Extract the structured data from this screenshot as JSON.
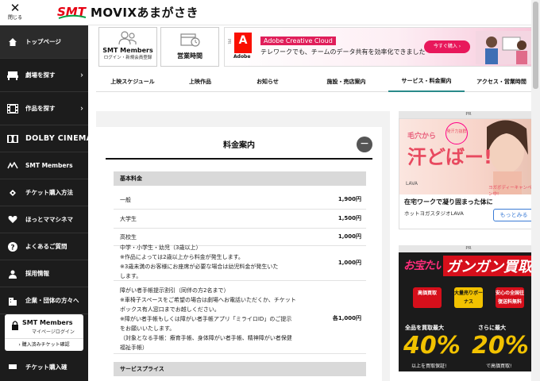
{
  "header": {
    "close_label": "閉じる",
    "close_symbol": "✕",
    "logo_text": "SMT",
    "site_title": "MOVIXあまがさき"
  },
  "sidebar": {
    "items": [
      {
        "label": "トップページ",
        "icon": "home-icon"
      },
      {
        "label": "劇場を探す",
        "icon": "theater-seat-icon",
        "chevron": "›"
      },
      {
        "label": "作品を探す",
        "icon": "film-icon",
        "chevron": "›"
      },
      {
        "label": "DOLBY CINEMA",
        "icon": "dolby-icon"
      },
      {
        "label": "SMT Members",
        "icon": "smt-logo-icon"
      },
      {
        "label": "チケット購入方法",
        "icon": "ticket-icon"
      },
      {
        "label": "ほっとママシネマ",
        "icon": "heart-icon"
      },
      {
        "label": "よくあるご質問",
        "icon": "question-icon"
      },
      {
        "label": "採用情報",
        "icon": "person-icon"
      },
      {
        "label": "企業・団体の方々へ",
        "icon": "building-icon"
      }
    ],
    "members": {
      "title": "SMT Members",
      "sub": "マイページログイン",
      "link": "購入済みチケット確認"
    },
    "bottom_label": "チケット購入確"
  },
  "cards": {
    "members": {
      "title": "SMT Members",
      "sub": "ログイン・新規会員登録"
    },
    "hours": {
      "title": "営業時間"
    }
  },
  "ad_banner": {
    "pr": "PR",
    "logo": "A",
    "brand": "Adobe",
    "headline": "Adobe Creative Cloud",
    "body": "テレワークでも、チームのデータ共有を効率化できました",
    "cta": "今すぐ購入 ›"
  },
  "tabs": [
    {
      "label": "上映スケジュール",
      "active": false
    },
    {
      "label": "上映作品",
      "active": false
    },
    {
      "label": "お知らせ",
      "active": false
    },
    {
      "label": "施設・売店案内",
      "active": false
    },
    {
      "label": "サービス・料金案内",
      "active": true
    },
    {
      "label": "アクセス・営業時間",
      "active": false
    }
  ],
  "content": {
    "title": "料金案内",
    "collapse_symbol": "−",
    "section_basic": "基本料金",
    "rows": [
      {
        "label": "一般",
        "price": "1,900円"
      },
      {
        "label": "大学生",
        "price": "1,500円"
      },
      {
        "label": "高校生",
        "price": "1,000円"
      },
      {
        "lines": [
          "中学・小学生・幼児（3歳以上）",
          "※作品によっては2歳以上から料金が発生します。",
          "※3歳未満のお客様にお座席が必要な場合は幼児料金が発生いた",
          "します。"
        ],
        "price": "1,000円"
      },
      {
        "lines": [
          "障がい者手帳提示割引（同伴の方2名まで）",
          "※車椅子スペースをご希望の場合は劇場へお電話いただくか、チケット",
          "ボックス有人窓口までお越しください。",
          "※障がい者手帳もしくは障がい者手帳アプリ「ミライロID」のご提示",
          "をお願いいたします。",
          "（対象となる手帳：療育手帳、身体障がい者手帳、精神障がい者保健",
          "福祉手帳）"
        ],
        "price": "各1,000円"
      }
    ],
    "section_service": "サービスプライス"
  },
  "ad2": {
    "pr": "PR",
    "caption1": "毛穴から",
    "caption2": "汗どばー!",
    "badge": "発汗力抜群",
    "lava": "LAVA",
    "small": "ヨガボディーキャンペーン中!",
    "title": "在宅ワークで凝り固まった体に",
    "source": "ホットヨガスタジオLAVA",
    "button": "もっとみる"
  },
  "ad3": {
    "pr": "PR",
    "top": "お宝たいむ",
    "big": "ガンガン買取",
    "tiles": [
      "高価買取",
      "大量売りボーナス",
      "安心の全国往復送料無料"
    ],
    "caption_left": "全品を買取最大",
    "caption_right": "さらに最大",
    "pct_left": "40%",
    "pct_right": "20%",
    "sub_left": "以上を買取保証!",
    "sub_right": "で高価買取!"
  }
}
